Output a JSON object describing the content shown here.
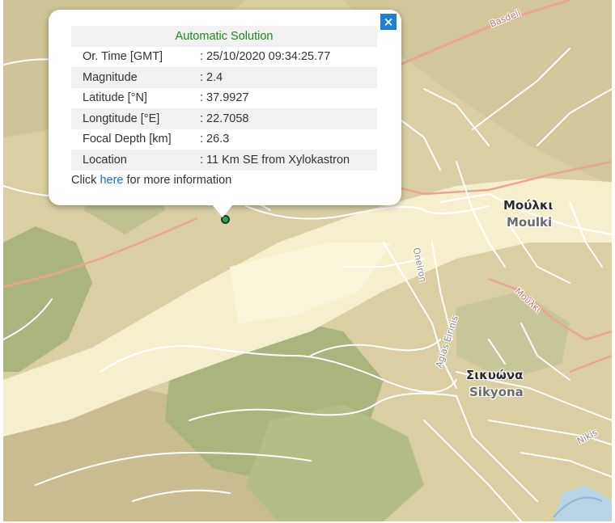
{
  "popup": {
    "title": "Automatic Solution",
    "rows": [
      {
        "label": "Or. Time [GMT]",
        "value": ": 25/10/2020 09:34:25.77"
      },
      {
        "label": "Magnitude",
        "value": ": 2.4"
      },
      {
        "label": "Latitude [°N]",
        "value": ": 37.9927"
      },
      {
        "label": "Longtitude [°E]",
        "value": ": 22.7058"
      },
      {
        "label": "Focal Depth [km]",
        "value": ": 26.3"
      },
      {
        "label": "Location",
        "value": ": 11 Km SE from Xylokastron"
      }
    ],
    "more": {
      "prefix": "Click",
      "link": "here",
      "suffix": "for more information"
    },
    "close_glyph": "×"
  },
  "map": {
    "places": [
      {
        "greek": "Μούλκι",
        "latin": "Moulki"
      },
      {
        "greek": "Σικυώνα",
        "latin": "Sikyona"
      }
    ],
    "streets": [
      "Basdeli",
      "Oneiron",
      "Agias Eirinis",
      "Μούλκι",
      "Nikis"
    ],
    "colors": {
      "terrain": "#d9cfa3",
      "valley": "#f6efce",
      "green": "#a9b57d",
      "road_major": "#e9a58e",
      "epicenter": "#2fa155"
    }
  }
}
